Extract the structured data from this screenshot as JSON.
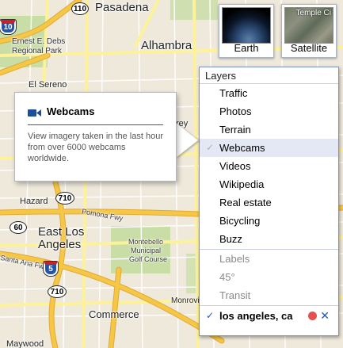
{
  "map": {
    "labels": {
      "pasadena": "Pasadena",
      "alhambra": "Alhambra",
      "el_sereno": "El Sereno",
      "ernest": "Ernest E. Debs",
      "ernest2": "Regional Park",
      "hazard": "Hazard",
      "pomona_fwy": "Pomona Fwy",
      "east_los": "East Los",
      "angeles": "Angeles",
      "montebello": "Montebello",
      "municipal": "Municipal",
      "golf": "Golf Course",
      "commerce": "Commerce",
      "monrovi": "Monrovi",
      "maywood": "Maywood",
      "santa_ana_fwy": "Santa Ana Fwy",
      "rey": "rey"
    },
    "shields": {
      "s110": "110",
      "s10": "10",
      "s710a": "710",
      "s60": "60",
      "s5": "5",
      "s710b": "710"
    }
  },
  "map_types": {
    "earth": "Earth",
    "satellite": "Satellite",
    "satellite_overlay": "Temple Ci"
  },
  "layers": {
    "header": "Layers",
    "items": [
      {
        "label": "Traffic"
      },
      {
        "label": "Photos"
      },
      {
        "label": "Terrain"
      },
      {
        "label": "Webcams",
        "checked": true
      },
      {
        "label": "Videos"
      },
      {
        "label": "Wikipedia"
      },
      {
        "label": "Real estate"
      },
      {
        "label": "Bicycling"
      },
      {
        "label": "Buzz"
      },
      {
        "label": "Labels",
        "disabled": true
      },
      {
        "label": "45°",
        "disabled": true
      },
      {
        "label": "Transit",
        "disabled": true
      }
    ],
    "search_result": "los angeles, ca",
    "check_glyph": "✓",
    "close_glyph": "✕"
  },
  "tooltip": {
    "title": "Webcams",
    "description": "View imagery taken in the last hour from over 6000 webcams worldwide.",
    "icon": "video-camera-icon"
  },
  "colors": {
    "highway": "#f5c745",
    "arterial": "#fdf29a",
    "park": "#c9dea6",
    "selected_bg": "#e4e8f5",
    "link_blue": "#2456b8",
    "marker_red": "#e94d4d"
  }
}
